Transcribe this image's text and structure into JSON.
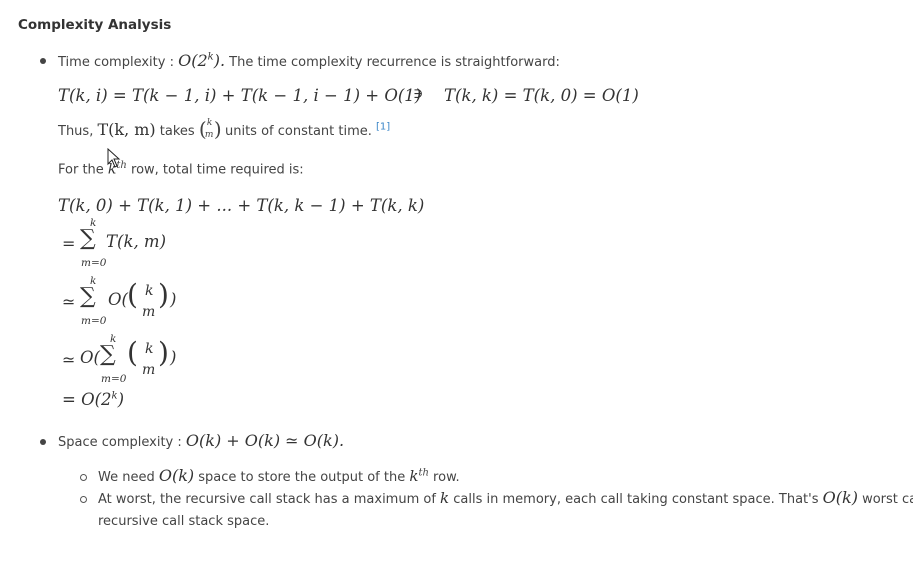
{
  "heading": "Complexity Analysis",
  "time": {
    "label": "Time complexity : ",
    "big_o": "O(2",
    "exp": "k",
    "close": ").",
    "desc": " The time complexity recurrence is straightforward:",
    "recurrence_left": "T(k, i) = T(k − 1, i) + T(k − 1, i − 1) + O(1)",
    "implies": "∋",
    "recurrence_right": "T(k, k) = T(k, 0) = O(1)",
    "thus_prefix": "Thus, ",
    "thus_math": "T(k, m)",
    "thus_takes": " takes ",
    "binom_top": "k",
    "binom_bottom": "m",
    "thus_suffix": " units of constant time. ",
    "ref": "[1]",
    "row_prefix": "For the ",
    "row_k": "k",
    "row_th": "th",
    "row_suffix": " row, total time required is:",
    "sum_line1": "T(k, 0) + T(k, 1) + ... + T(k, k − 1) + T(k, k)",
    "eq": "=",
    "approx": "≃",
    "sum_upper": "k",
    "sum_lower": "m=0",
    "sum_term1": "T(k, m)",
    "o_open": "O(",
    "o_close": ")",
    "final": "= O(2",
    "final_exp": "k",
    "final_close": ")"
  },
  "space": {
    "label": "Space complexity : ",
    "math": "O(k) + O(k) ≃ O(k).",
    "sub1_prefix": "We need ",
    "sub1_math": "O(k)",
    "sub1_mid": " space to store the output of the ",
    "sub1_k": "k",
    "sub1_th": "th",
    "sub1_suffix": " row.",
    "sub2_prefix": "At worst, the recursive call stack has a maximum of ",
    "sub2_k": "k",
    "sub2_mid": " calls in memory, each call taking constant space. That's ",
    "sub2_math": "O(k)",
    "sub2_suffix": " worst case",
    "sub2_line2": "recursive call stack space."
  }
}
